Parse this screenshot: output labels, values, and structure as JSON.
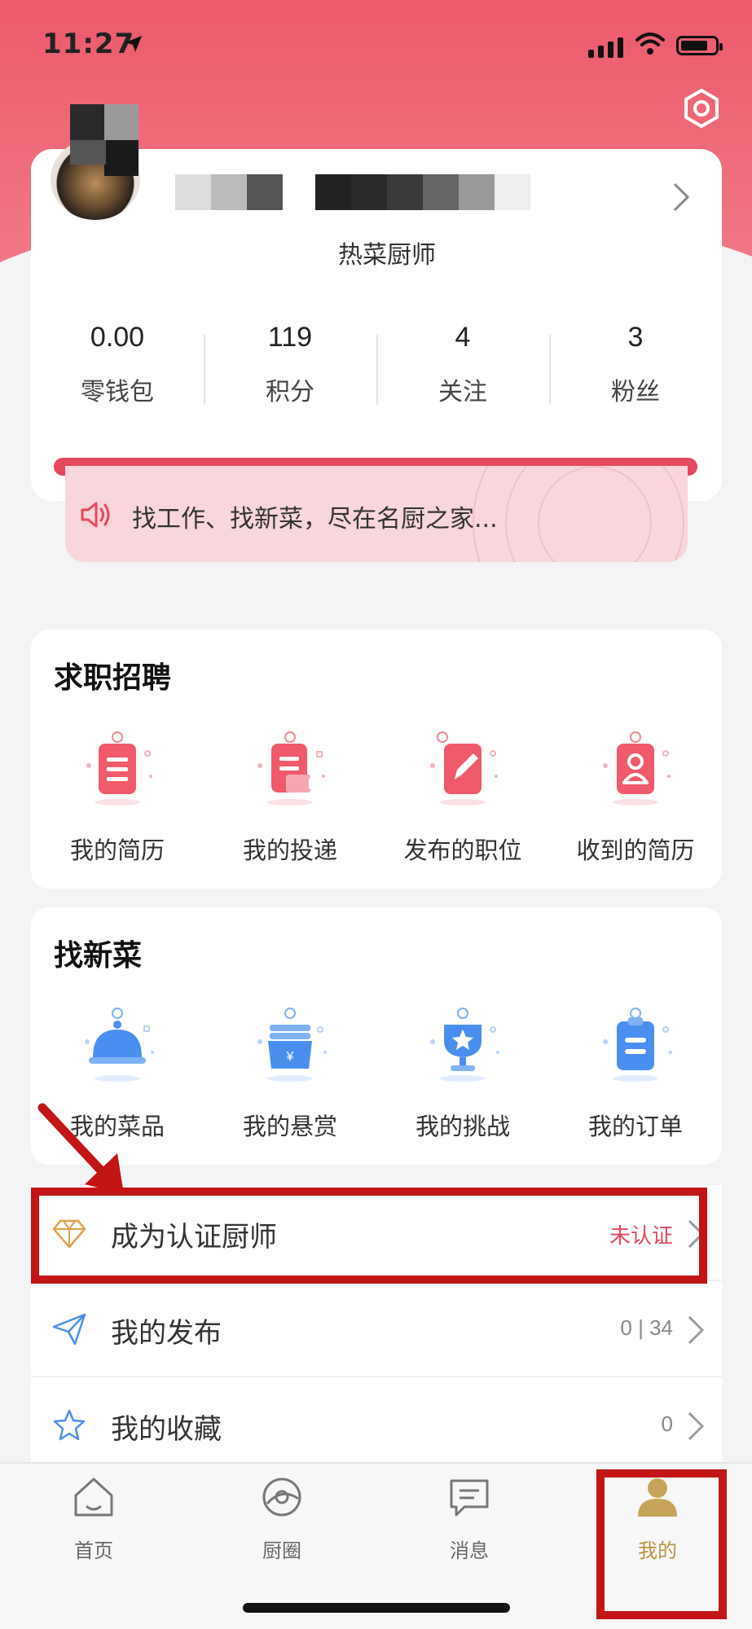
{
  "status_bar": {
    "time": "11:27"
  },
  "profile": {
    "title_badge": "热菜厨师",
    "stats": [
      {
        "value": "0.00",
        "label": "零钱包"
      },
      {
        "value": "119",
        "label": "积分"
      },
      {
        "value": "4",
        "label": "关注"
      },
      {
        "value": "3",
        "label": "粉丝"
      }
    ]
  },
  "notice": {
    "text": "找工作、找新菜，尽在名厨之家..."
  },
  "jobs": {
    "title": "求职招聘",
    "items": [
      {
        "label": "我的简历",
        "icon": "resume-icon"
      },
      {
        "label": "我的投递",
        "icon": "send-resume-icon"
      },
      {
        "label": "发布的职位",
        "icon": "post-job-icon"
      },
      {
        "label": "收到的简历",
        "icon": "received-resume-icon"
      }
    ]
  },
  "dishes": {
    "title": "找新菜",
    "items": [
      {
        "label": "我的菜品",
        "icon": "cloche-icon"
      },
      {
        "label": "我的悬赏",
        "icon": "reward-icon"
      },
      {
        "label": "我的挑战",
        "icon": "trophy-icon"
      },
      {
        "label": "我的订单",
        "icon": "order-icon"
      }
    ]
  },
  "list": [
    {
      "label": "成为认证厨师",
      "value": "未认证",
      "icon": "diamond-icon"
    },
    {
      "label": "我的发布",
      "value": "0 | 34",
      "icon": "paper-plane-icon"
    },
    {
      "label": "我的收藏",
      "value": "0",
      "icon": "star-icon"
    }
  ],
  "tabs": [
    {
      "label": "首页",
      "icon": "home-icon"
    },
    {
      "label": "厨圈",
      "icon": "circle-icon"
    },
    {
      "label": "消息",
      "icon": "message-icon"
    },
    {
      "label": "我的",
      "icon": "profile-icon",
      "active": true
    }
  ],
  "colors": {
    "brand": "#ec5a6b",
    "accent_gold": "#b8933f",
    "highlight_red": "#c41515",
    "icon_blue": "#4a8ff0"
  }
}
